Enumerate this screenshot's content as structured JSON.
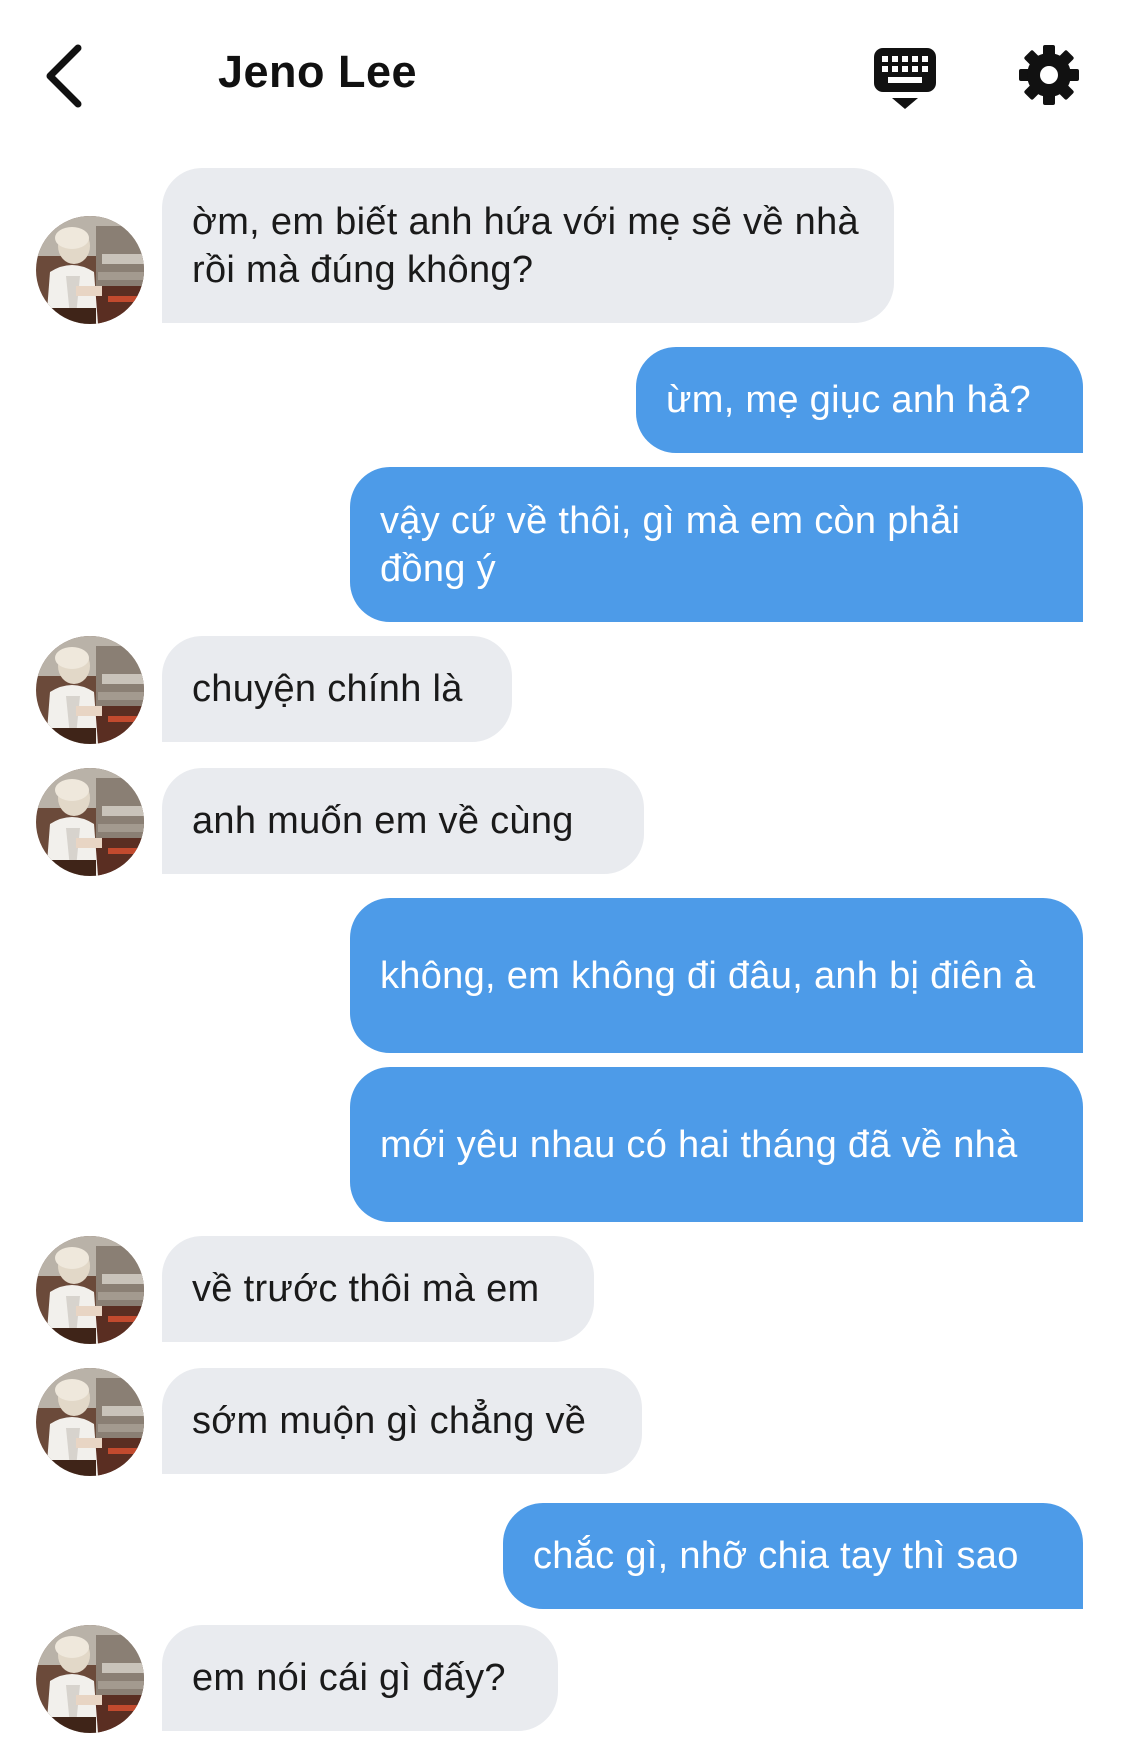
{
  "header": {
    "title": "Jeno Lee",
    "back_icon": "chevron-left-icon",
    "keyboard_icon": "keyboard-icon",
    "settings_icon": "gear-icon"
  },
  "colors": {
    "incoming_bubble": "#e9ebef",
    "outgoing_bubble": "#4d9be8",
    "outgoing_text": "#ffffff",
    "incoming_text": "#1a1a1a"
  },
  "messages": [
    {
      "from": "them",
      "text": "ờm, em biết anh hứa với mẹ sẽ về nhà rồi mà đúng không?"
    },
    {
      "from": "me",
      "text": "ừm, mẹ giục anh hả?"
    },
    {
      "from": "me",
      "text": "vậy cứ về thôi, gì mà em còn phải đồng ý"
    },
    {
      "from": "them",
      "text": "chuyện chính là"
    },
    {
      "from": "them",
      "text": "anh muốn em về cùng"
    },
    {
      "from": "me",
      "text": "không, em không đi đâu, anh bị điên à"
    },
    {
      "from": "me",
      "text": "mới yêu nhau có hai tháng đã về nhà"
    },
    {
      "from": "them",
      "text": "về trước thôi mà em"
    },
    {
      "from": "them",
      "text": "sớm muộn gì chẳng về"
    },
    {
      "from": "me",
      "text": "chắc gì, nhỡ chia tay thì sao"
    },
    {
      "from": "them",
      "text": "em nói cái gì đấy?"
    }
  ]
}
